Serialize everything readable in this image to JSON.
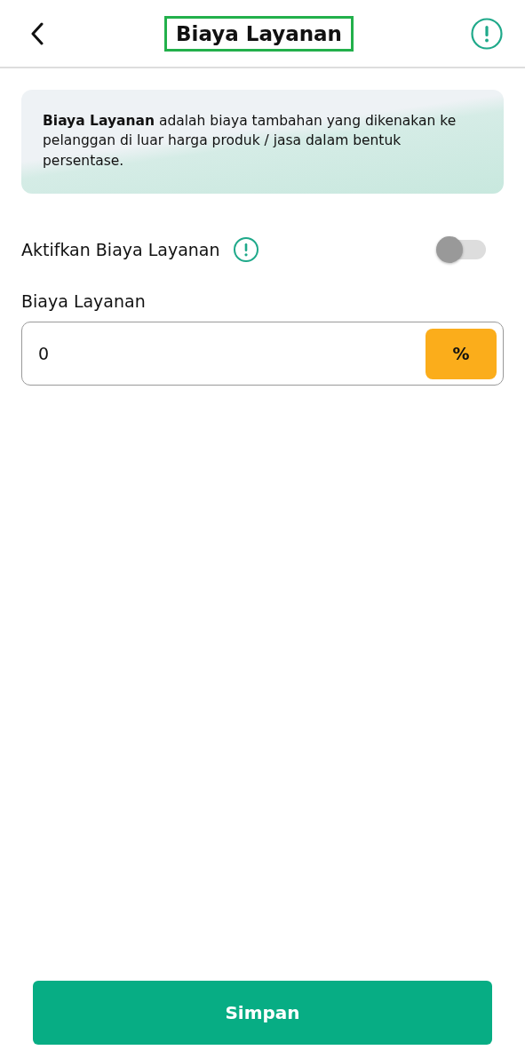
{
  "header": {
    "title": "Biaya Layanan",
    "title_highlighted": true
  },
  "info_card": {
    "text": "**Biaya Layanan** adalah biaya tambahan yang dikenakan ke pelanggan di luar harga produk / jasa dalam bentuk persentase."
  },
  "toggle_row": {
    "label": "Aktifkan Biaya Layanan",
    "on": false
  },
  "fee_field": {
    "label": "Biaya Layanan",
    "value": "0",
    "suffix": "%"
  },
  "save_button": {
    "label": "Simpan"
  }
}
